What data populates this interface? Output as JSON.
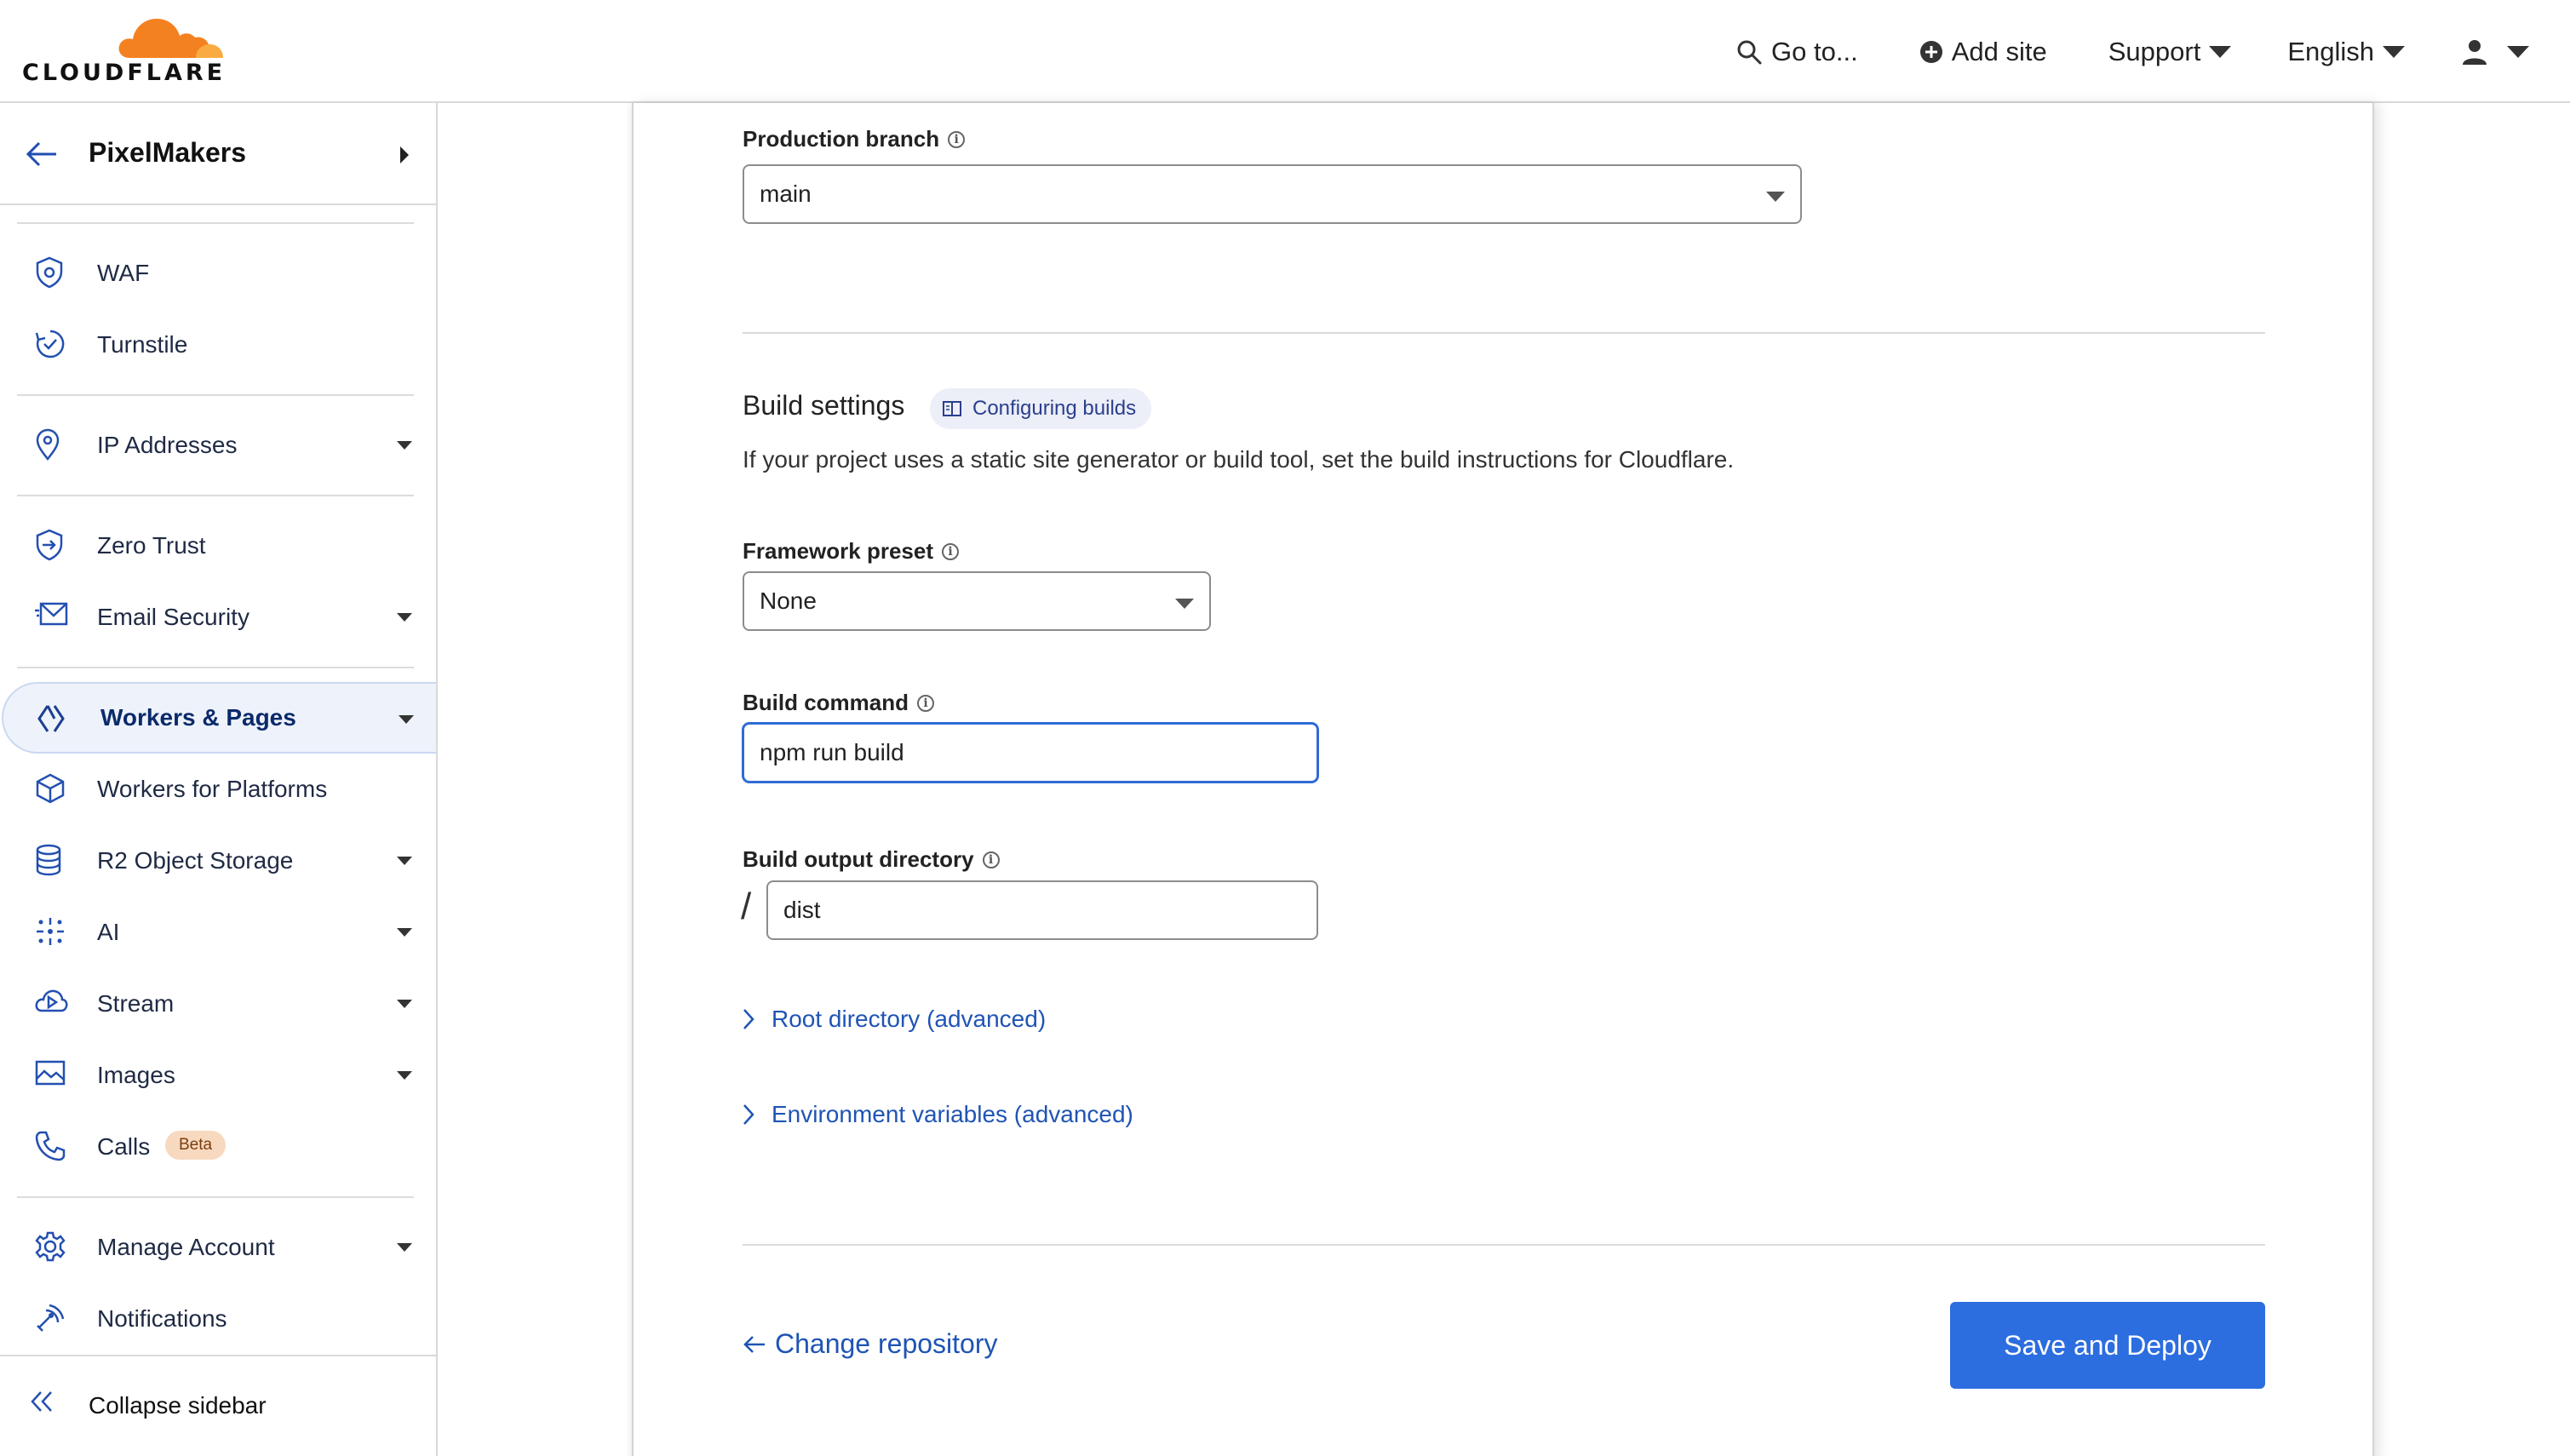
{
  "brand": {
    "wordmark": "CLOUDFLARE",
    "accent": "#f48120"
  },
  "topnav": {
    "goto_label": "Go to...",
    "add_site_label": "Add site",
    "support_label": "Support",
    "language_label": "English"
  },
  "sidebar": {
    "account_name": "PixelMakers",
    "items": [
      {
        "label": "WAF",
        "icon": "shield-icon"
      },
      {
        "label": "Turnstile",
        "icon": "turnstile-icon"
      },
      {
        "label": "IP Addresses",
        "icon": "location-pin-icon"
      },
      {
        "label": "Zero Trust",
        "icon": "zero-trust-icon"
      },
      {
        "label": "Email Security",
        "icon": "email-icon"
      },
      {
        "label": "Workers & Pages",
        "icon": "workers-icon"
      },
      {
        "label": "Workers for Platforms",
        "icon": "cube-icon"
      },
      {
        "label": "R2 Object Storage",
        "icon": "database-icon"
      },
      {
        "label": "AI",
        "icon": "sparkle-icon"
      },
      {
        "label": "Stream",
        "icon": "stream-cloud-icon"
      },
      {
        "label": "Images",
        "icon": "image-icon"
      },
      {
        "label": "Calls",
        "icon": "phone-icon",
        "badge": "Beta"
      },
      {
        "label": "Manage Account",
        "icon": "gear-icon"
      },
      {
        "label": "Notifications",
        "icon": "antenna-icon"
      }
    ],
    "collapse_label": "Collapse sidebar"
  },
  "form": {
    "production_branch": {
      "label": "Production branch",
      "value": "main"
    },
    "build_settings": {
      "title": "Build settings",
      "docs_link": "Configuring builds",
      "description": "If your project uses a static site generator or build tool, set the build instructions for Cloudflare."
    },
    "framework_preset": {
      "label": "Framework preset",
      "value": "None"
    },
    "build_command": {
      "label": "Build command",
      "value": "npm run build"
    },
    "build_output": {
      "label": "Build output directory",
      "prefix": "/",
      "value": "dist"
    },
    "root_directory_label": "Root directory (advanced)",
    "env_vars_label": "Environment variables (advanced)",
    "change_repo_label": "Change repository",
    "save_deploy_label": "Save and Deploy"
  },
  "colors": {
    "primary": "#2c6de0",
    "link": "#1f54b4",
    "active_bg": "#eef3fb"
  }
}
